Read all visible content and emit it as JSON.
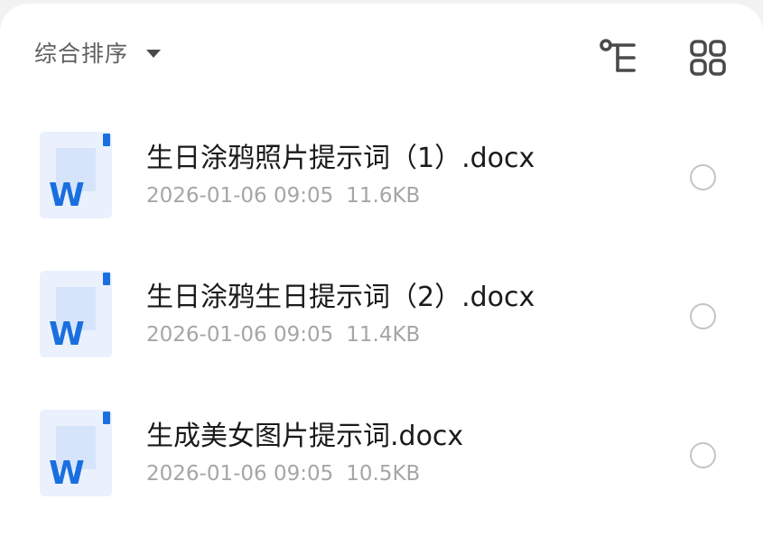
{
  "toolbar": {
    "sort_label": "综合排序",
    "sort_caret_icon": "caret-down-icon",
    "tree_view_icon": "tree-view-icon",
    "grid_view_icon": "grid-view-icon"
  },
  "files": [
    {
      "name": "生日涂鸦照片提示词（1）.docx",
      "date": "2026-01-06 09:05",
      "size": "11.6KB",
      "icon": "word-doc-icon"
    },
    {
      "name": "生日涂鸦生日提示词（2）.docx",
      "date": "2026-01-06 09:05",
      "size": "11.4KB",
      "icon": "word-doc-icon"
    },
    {
      "name": "生成美女图片提示词.docx",
      "date": "2026-01-06 09:05",
      "size": "10.5KB",
      "icon": "word-doc-icon"
    }
  ],
  "colors": {
    "word_blue": "#1a6fe0",
    "doc_bg": "#eaf1fd",
    "text_primary": "#1a1a1a",
    "text_secondary": "#a6a6a6",
    "icon_gray": "#4a4a4a"
  }
}
